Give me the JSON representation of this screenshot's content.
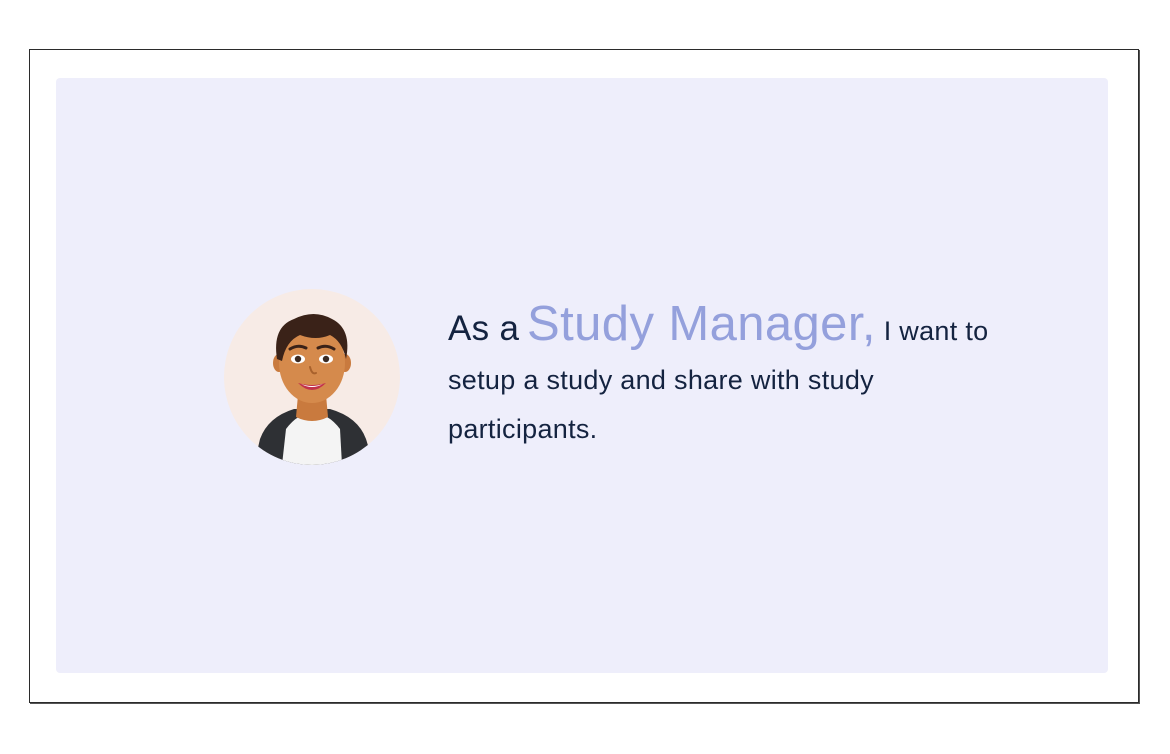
{
  "story": {
    "lead": "As a",
    "role": "Study Manager,",
    "body": "I want to setup a study and share with study participants."
  },
  "avatar": {
    "icon": "woman-avatar-icon",
    "background": "#f7ebe6"
  },
  "colors": {
    "panel_background": "#eeeefb",
    "role_accent": "#94a0dc",
    "text": "#142340"
  }
}
